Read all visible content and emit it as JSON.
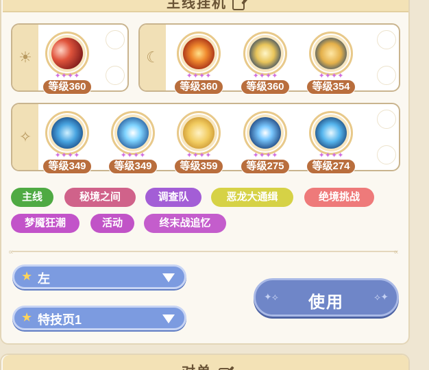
{
  "top_panel": {
    "title": "主线挂机"
  },
  "groups": [
    {
      "symbol": "☀",
      "skills": [
        {
          "level": "等级360",
          "stars": "✦✦✦✦",
          "art": "red-slash"
        }
      ]
    },
    {
      "symbol": "☾",
      "skills": [
        {
          "level": "等级360",
          "stars": "✦✦✦✦",
          "art": "fire-burst"
        },
        {
          "level": "等级360",
          "stars": "✦✦✦✦",
          "art": "gold-light"
        },
        {
          "level": "等级354",
          "stars": "✦✦✦✦",
          "art": "gold-cloud"
        }
      ]
    },
    {
      "symbol": "✧",
      "skills": [
        {
          "level": "等级349",
          "stars": "✦✦✦✦",
          "art": "blue-wing"
        },
        {
          "level": "等级349",
          "stars": "✦✦✦✦",
          "art": "blue-burst"
        },
        {
          "level": "等级359",
          "stars": "✦✦✦✦",
          "art": "gold-swirl"
        },
        {
          "level": "等级275",
          "stars": "✦✦✦✦",
          "art": "blue-eye"
        },
        {
          "level": "等级274",
          "stars": "✦✦✦✦",
          "art": "blue-strike"
        }
      ]
    }
  ],
  "tags": [
    {
      "label": "主线",
      "color": "#4faa43"
    },
    {
      "label": "秘境之间",
      "color": "#d0628a"
    },
    {
      "label": "调查队",
      "color": "#a35ed6"
    },
    {
      "label": "恶龙大通缉",
      "color": "#d6d246"
    },
    {
      "label": "绝境挑战",
      "color": "#ee7a7a"
    },
    {
      "label": "梦魇狂潮",
      "color": "#c253c9"
    },
    {
      "label": "活动",
      "color": "#c153c7"
    },
    {
      "label": "终末战追忆",
      "color": "#c45dcc"
    }
  ],
  "dropdowns": {
    "position": "左",
    "page": "特技页1"
  },
  "use_button": {
    "label": "使用"
  },
  "bottom_panel": {
    "title": "对单"
  },
  "icons": {
    "star": "star-icon",
    "chevron": "chevron-down-icon",
    "edit": "edit-icon"
  }
}
